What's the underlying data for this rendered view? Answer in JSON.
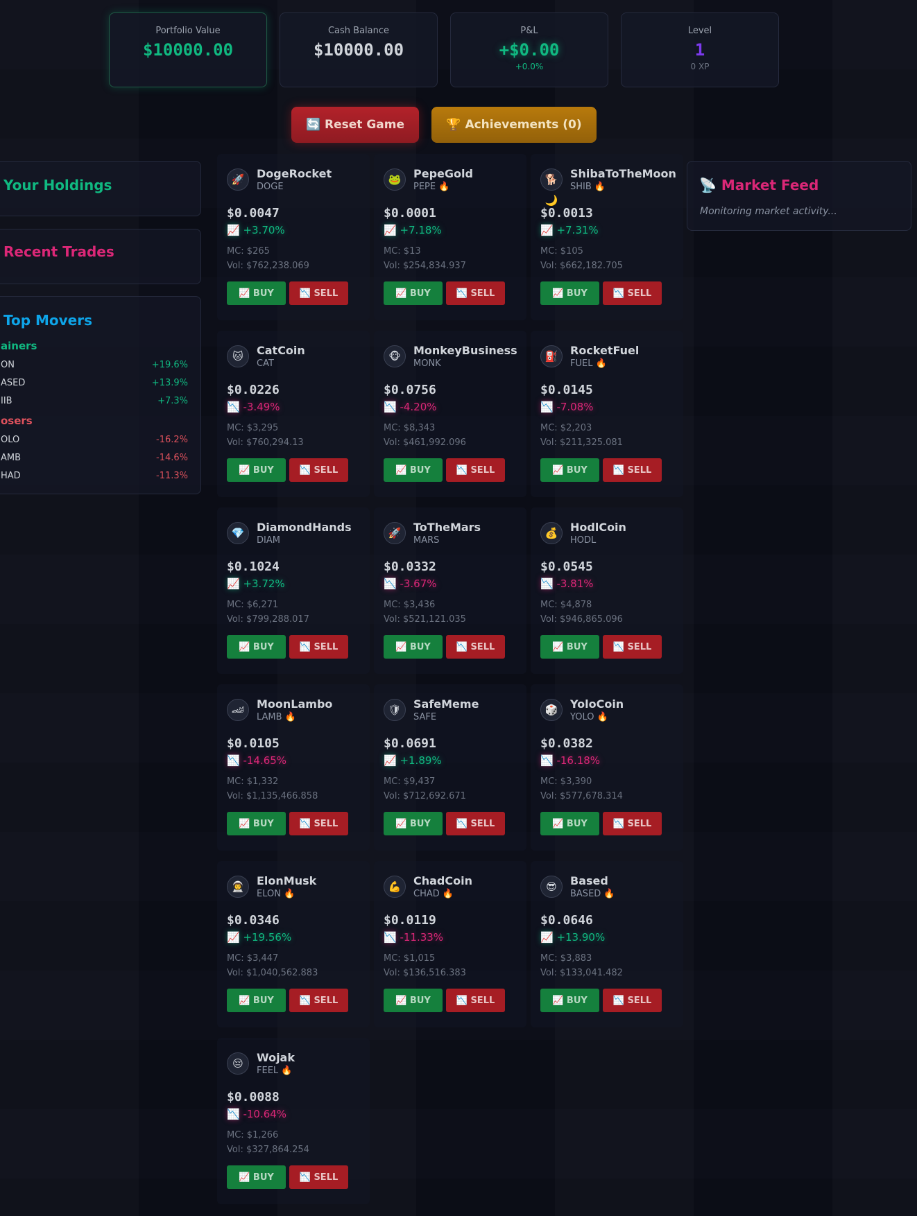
{
  "stats": {
    "portfolio": {
      "label": "Portfolio Value",
      "value": "$10000.00"
    },
    "cash": {
      "label": "Cash Balance",
      "value": "$10000.00"
    },
    "pnl": {
      "label": "P&L",
      "value": "+$0.00",
      "sub": "+0.0%"
    },
    "level": {
      "label": "Level",
      "value": "1",
      "sub": "0 XP"
    }
  },
  "actions": {
    "reset": "🔄 Reset Game",
    "achievements": "🏆 Achievements (0)"
  },
  "panels": {
    "holdings": {
      "title": "Your Holdings"
    },
    "recent": {
      "title": "Recent Trades"
    },
    "movers": {
      "title": "Top Movers",
      "gainers_label": "ainers",
      "losers_label": "osers",
      "gainers": [
        {
          "symbol": "ON",
          "pct": "+19.6%"
        },
        {
          "symbol": "ASED",
          "pct": "+13.9%"
        },
        {
          "symbol": "IIB",
          "pct": "+7.3%"
        }
      ],
      "losers": [
        {
          "symbol": "OLO",
          "pct": "-16.2%"
        },
        {
          "symbol": "AMB",
          "pct": "-14.6%"
        },
        {
          "symbol": "HAD",
          "pct": "-11.3%"
        }
      ]
    },
    "feed": {
      "title": "📡 Market Feed",
      "placeholder": "Monitoring market activity..."
    }
  },
  "buttons": {
    "buy": "📈 BUY",
    "sell": "📉 SELL"
  },
  "colors": {
    "up": "#10b981",
    "down": "#db2777",
    "accent_green": "#10b981",
    "accent_pink": "#db2777",
    "accent_cyan": "#0ea5e9",
    "accent_purple": "#7c3aed"
  },
  "coins": [
    {
      "name": "DogeRocket",
      "symbol": "DOGE",
      "icon": "🚀",
      "icon_name": "rocket-icon",
      "price": "$0.0047",
      "change": "📈 +3.70%",
      "dir": "up",
      "mc": "MC: $265",
      "vol": "Vol: $762,238.069"
    },
    {
      "name": "PepeGold",
      "symbol": "PEPE 🔥",
      "icon": "🐸",
      "icon_name": "frog-icon",
      "price": "$0.0001",
      "change": "📈 +7.18%",
      "dir": "up",
      "mc": "MC: $13",
      "vol": "Vol: $254,834.937"
    },
    {
      "name": "ShibaToTheMoon",
      "symbol": "SHIB 🔥",
      "icon": "🐕🌙",
      "icon_name": "dog-moon-icon",
      "price": "$0.0013",
      "change": "📈 +7.31%",
      "dir": "up",
      "mc": "MC: $105",
      "vol": "Vol: $662,182.705"
    },
    {
      "name": "CatCoin",
      "symbol": "CAT",
      "icon": "🐱",
      "icon_name": "cat-icon",
      "price": "$0.0226",
      "change": "📉 -3.49%",
      "dir": "down",
      "mc": "MC: $3,295",
      "vol": "Vol: $760,294.13"
    },
    {
      "name": "MonkeyBusiness",
      "symbol": "MONK",
      "icon": "🐵",
      "icon_name": "monkey-icon",
      "price": "$0.0756",
      "change": "📉 -4.20%",
      "dir": "down",
      "mc": "MC: $8,343",
      "vol": "Vol: $461,992.096"
    },
    {
      "name": "RocketFuel",
      "symbol": "FUEL 🔥",
      "icon": "⛽",
      "icon_name": "fuel-icon",
      "price": "$0.0145",
      "change": "📉 -7.08%",
      "dir": "down",
      "mc": "MC: $2,203",
      "vol": "Vol: $211,325.081"
    },
    {
      "name": "DiamondHands",
      "symbol": "DIAM",
      "icon": "💎",
      "icon_name": "diamond-icon",
      "price": "$0.1024",
      "change": "📈 +3.72%",
      "dir": "up",
      "mc": "MC: $6,271",
      "vol": "Vol: $799,288.017"
    },
    {
      "name": "ToTheMars",
      "symbol": "MARS",
      "icon": "🚀",
      "icon_name": "planet-icon",
      "price": "$0.0332",
      "change": "📉 -3.67%",
      "dir": "down",
      "mc": "MC: $3,436",
      "vol": "Vol: $521,121.035"
    },
    {
      "name": "HodlCoin",
      "symbol": "HODL",
      "icon": "💰",
      "icon_name": "money-bag-icon",
      "price": "$0.0545",
      "change": "📉 -3.81%",
      "dir": "down",
      "mc": "MC: $4,878",
      "vol": "Vol: $946,865.096"
    },
    {
      "name": "MoonLambo",
      "symbol": "LAMB 🔥",
      "icon": "🏎",
      "icon_name": "car-icon",
      "price": "$0.0105",
      "change": "📉 -14.65%",
      "dir": "down",
      "mc": "MC: $1,332",
      "vol": "Vol: $1,135,466.858"
    },
    {
      "name": "SafeMeme",
      "symbol": "SAFE",
      "icon": "🛡",
      "icon_name": "shield-icon",
      "price": "$0.0691",
      "change": "📈 +1.89%",
      "dir": "up",
      "mc": "MC: $9,437",
      "vol": "Vol: $712,692.671"
    },
    {
      "name": "YoloCoin",
      "symbol": "YOLO 🔥",
      "icon": "🎲",
      "icon_name": "dice-icon",
      "price": "$0.0382",
      "change": "📉 -16.18%",
      "dir": "down",
      "mc": "MC: $3,390",
      "vol": "Vol: $577,678.314"
    },
    {
      "name": "ElonMusk",
      "symbol": "ELON 🔥",
      "icon": "👨‍🚀",
      "icon_name": "astronaut-icon",
      "price": "$0.0346",
      "change": "📈 +19.56%",
      "dir": "up",
      "mc": "MC: $3,447",
      "vol": "Vol: $1,040,562.883"
    },
    {
      "name": "ChadCoin",
      "symbol": "CHAD 🔥",
      "icon": "💪",
      "icon_name": "muscle-icon",
      "price": "$0.0119",
      "change": "📉 -11.33%",
      "dir": "down",
      "mc": "MC: $1,015",
      "vol": "Vol: $136,516.383"
    },
    {
      "name": "Based",
      "symbol": "BASED 🔥",
      "icon": "😎",
      "icon_name": "sunglasses-icon",
      "price": "$0.0646",
      "change": "📈 +13.90%",
      "dir": "up",
      "mc": "MC: $3,883",
      "vol": "Vol: $133,041.482"
    },
    {
      "name": "Wojak",
      "symbol": "FEEL 🔥",
      "icon": "😔",
      "icon_name": "sad-face-icon",
      "price": "$0.0088",
      "change": "📉 -10.64%",
      "dir": "down",
      "mc": "MC: $1,266",
      "vol": "Vol: $327,864.254"
    }
  ]
}
